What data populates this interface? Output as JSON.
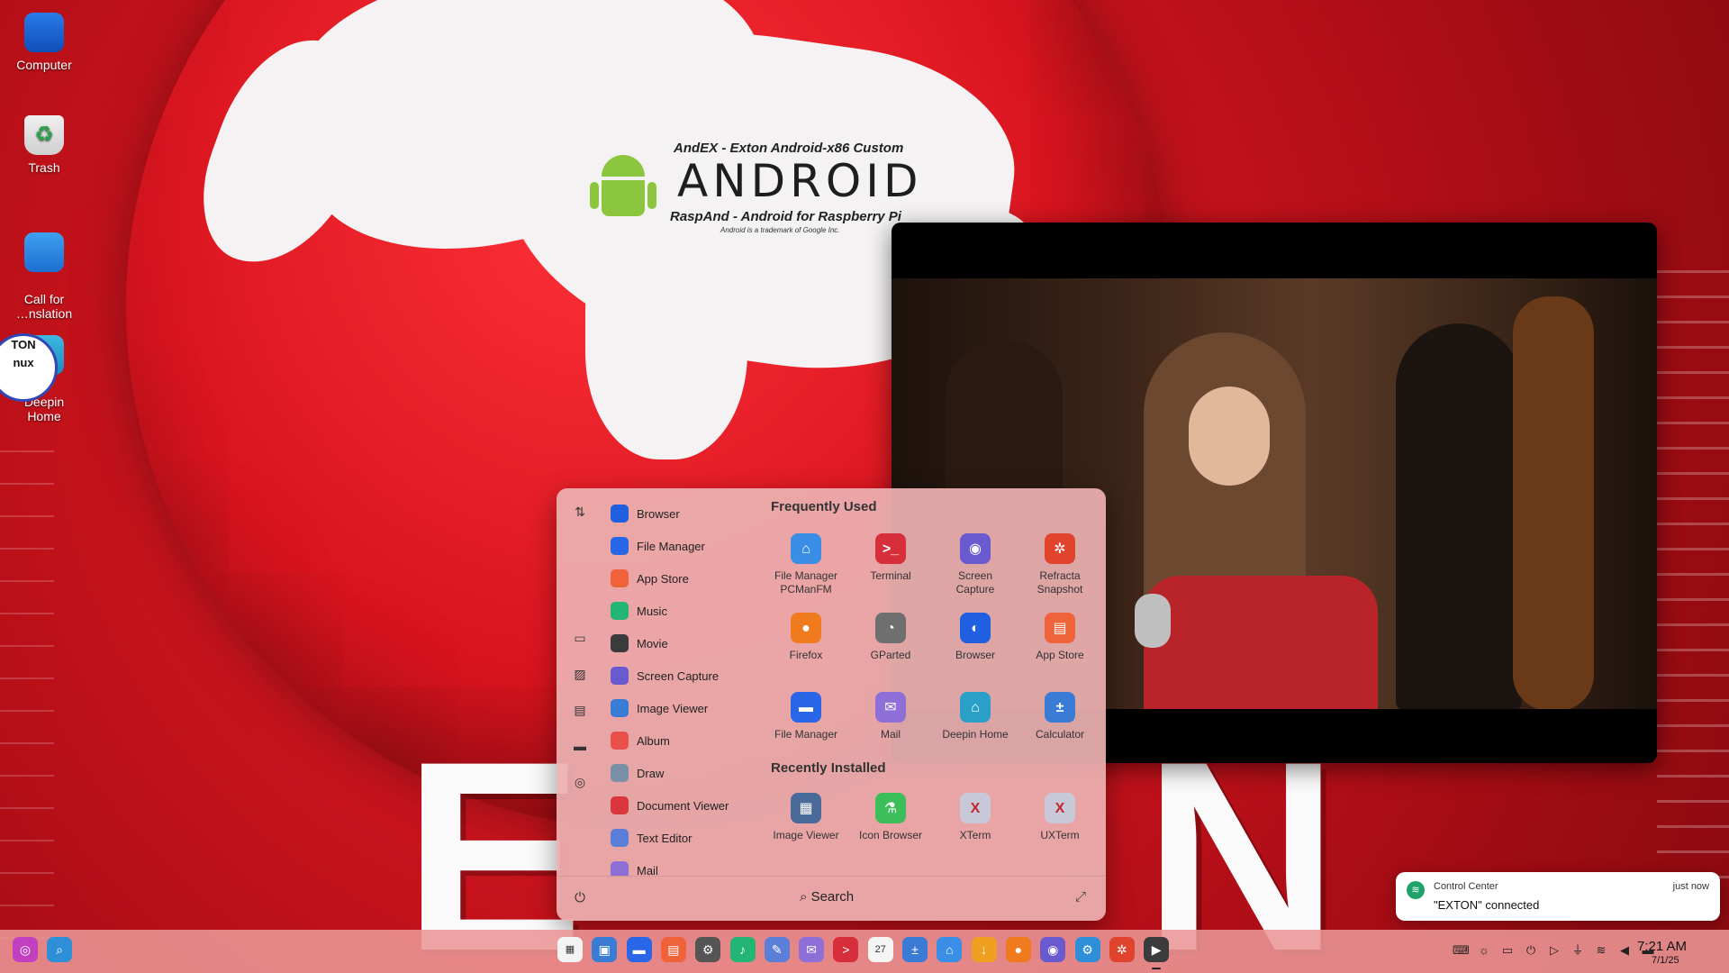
{
  "desktop": {
    "icons": [
      {
        "label": "Computer",
        "icon": "computer-icon"
      },
      {
        "label": "Trash",
        "icon": "trash-icon"
      },
      {
        "label": "Call for\n…nslation",
        "icon": "translation-icon"
      },
      {
        "label": "Deepin\nHome",
        "icon": "deepin-home-icon"
      }
    ],
    "stamp": {
      "line1": "TON",
      "line2": "nux"
    }
  },
  "wallpaper": {
    "banner_top": "AndEX - Exton Android-x86 Custom",
    "banner_big": "ANDROID",
    "banner_bottom": "RaspAnd - Android for Raspberry Pi",
    "banner_tm": "Android is a trademark of Google Inc.",
    "big_letters_left": "E",
    "big_letters_right": "N"
  },
  "launcher": {
    "categories": [
      "sort-icon",
      "monitor-icon",
      "image-icon",
      "document-icon",
      "desktop-icon",
      "network-icon"
    ],
    "app_list": [
      {
        "label": "Browser",
        "color": "#1f5fe0"
      },
      {
        "label": "File Manager",
        "color": "#2a66e8"
      },
      {
        "label": "App Store",
        "color": "#f0623a"
      },
      {
        "label": "Music",
        "color": "#22b573"
      },
      {
        "label": "Movie",
        "color": "#3b3b3b"
      },
      {
        "label": "Screen Capture",
        "color": "#6a5ad0"
      },
      {
        "label": "Image Viewer",
        "color": "#3a7bd5"
      },
      {
        "label": "Album",
        "color": "#e8504a"
      },
      {
        "label": "Draw",
        "color": "#7a8fa8"
      },
      {
        "label": "Document Viewer",
        "color": "#d9363e"
      },
      {
        "label": "Text Editor",
        "color": "#5b7fd9"
      },
      {
        "label": "Mail",
        "color": "#8e6fd8"
      }
    ],
    "frequently_used_title": "Frequently Used",
    "frequently_used": [
      {
        "label": "File Manager\nPCManFM",
        "color": "#3a8ee6",
        "glyph": "⌂"
      },
      {
        "label": "Terminal",
        "color": "#d62e3a",
        "glyph": ">_"
      },
      {
        "label": "Screen\nCapture",
        "color": "#6a5ad0",
        "glyph": "◉"
      },
      {
        "label": "Refracta\nSnapshot",
        "color": "#e0442c",
        "glyph": "✲"
      },
      {
        "label": "Firefox",
        "color": "#f07a1e",
        "glyph": "●"
      },
      {
        "label": "GParted",
        "color": "#6f6f6f",
        "glyph": "◔"
      },
      {
        "label": "Browser",
        "color": "#1f5fe0",
        "glyph": "◐"
      },
      {
        "label": "App Store",
        "color": "#f0623a",
        "glyph": "▤"
      },
      {
        "label": "File Manager",
        "color": "#2a66e8",
        "glyph": "▬"
      },
      {
        "label": "Mail",
        "color": "#8e6fd8",
        "glyph": "✉"
      },
      {
        "label": "Deepin Home",
        "color": "#2aa0c8",
        "glyph": "⌂"
      },
      {
        "label": "Calculator",
        "color": "#3a7bd5",
        "glyph": "±"
      }
    ],
    "recently_installed_title": "Recently Installed",
    "recently_installed": [
      {
        "label": "Image Viewer",
        "color": "#4a6a9a",
        "glyph": "▦"
      },
      {
        "label": "Icon Browser",
        "color": "#3cbf5a",
        "glyph": "⚗"
      },
      {
        "label": "XTerm",
        "color": "#c8c8d8",
        "glyph": "X"
      },
      {
        "label": "UXTerm",
        "color": "#c8c8d8",
        "glyph": "X"
      }
    ],
    "search_label": "Search"
  },
  "notification": {
    "app": "Control Center",
    "time": "just now",
    "body": "\"EXTON\" connected"
  },
  "taskbar": {
    "left_icons": [
      {
        "name": "launcher-icon",
        "color": "#c040c0",
        "glyph": "◎"
      },
      {
        "name": "search-icon",
        "color": "#2e8fd8",
        "glyph": "⌕"
      }
    ],
    "center_icons": [
      {
        "name": "app-grid-icon",
        "color": "#f3f3f3",
        "glyph": "▦"
      },
      {
        "name": "multitask-icon",
        "color": "#3a7bd5",
        "glyph": "▣"
      },
      {
        "name": "file-manager-icon",
        "color": "#2a66e8",
        "glyph": "▬"
      },
      {
        "name": "app-store-icon",
        "color": "#f0623a",
        "glyph": "▤"
      },
      {
        "name": "settings-icon",
        "color": "#555555",
        "glyph": "⚙"
      },
      {
        "name": "music-icon",
        "color": "#22b573",
        "glyph": "♪"
      },
      {
        "name": "text-editor-icon",
        "color": "#5b7fd9",
        "glyph": "✎"
      },
      {
        "name": "mail-icon",
        "color": "#8e6fd8",
        "glyph": "✉"
      },
      {
        "name": "terminal-icon",
        "color": "#d62e3a",
        "glyph": ">"
      },
      {
        "name": "calendar-icon",
        "color": "#f5f5f5",
        "glyph": "27"
      },
      {
        "name": "calculator-icon",
        "color": "#3a7bd5",
        "glyph": "±"
      },
      {
        "name": "pcmanfm-icon",
        "color": "#3a8ee6",
        "glyph": "⌂"
      },
      {
        "name": "downloader-icon",
        "color": "#f0a020",
        "glyph": "↓"
      },
      {
        "name": "firefox-icon",
        "color": "#f07a1e",
        "glyph": "●"
      },
      {
        "name": "screen-capture-icon",
        "color": "#6a5ad0",
        "glyph": "◉"
      },
      {
        "name": "control-center-icon",
        "color": "#2e8fd8",
        "glyph": "⚙"
      },
      {
        "name": "refracta-icon",
        "color": "#e0442c",
        "glyph": "✲"
      },
      {
        "name": "movie-icon",
        "color": "#3b3b3b",
        "glyph": "▶"
      }
    ],
    "tray_icons": [
      "keyboard-icon",
      "brightness-icon",
      "battery-icon",
      "power-icon",
      "play-circle-icon",
      "usb-icon",
      "wifi-icon",
      "volume-icon",
      "drive-icon"
    ],
    "clock_time": "7:21 AM",
    "clock_date": "7/1/25"
  }
}
